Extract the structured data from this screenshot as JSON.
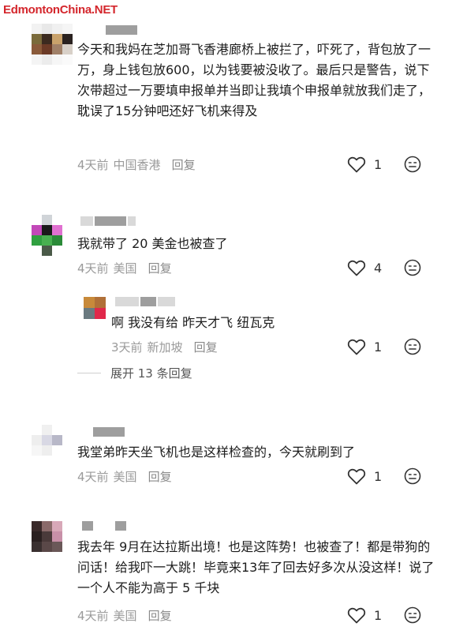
{
  "watermark": "EdmontonChina.NET",
  "comments": [
    {
      "text": "今天和我妈在芝加哥飞香港廊桥上被拦了，吓死了，背包放了一万，身上钱包放600，以为钱要被没收了。最后只是警告，说下次带超过一万要填申报单并当即让我填个申报单就放我们走了，耽误了15分钟吧还好飞机来得及",
      "time": "4天前",
      "location": "中国香港",
      "reply_label": "回复",
      "likes": "1"
    },
    {
      "text": "我就带了 20 美金也被查了",
      "time": "4天前",
      "location": "美国",
      "reply_label": "回复",
      "likes": "4",
      "reply": {
        "text": "啊 我没有给 昨天才飞 纽瓦克",
        "time": "3天前",
        "location": "新加坡",
        "reply_label": "回复",
        "likes": "1"
      },
      "expand_label": "展开 13 条回复"
    },
    {
      "text": "我堂弟昨天坐飞机也是这样检查的，今天就刷到了",
      "time": "4天前",
      "location": "美国",
      "reply_label": "回复",
      "likes": "1"
    },
    {
      "text": "我去年 9月在达拉斯出境！也是这阵势！也被查了！都是带狗的问话！给我吓一大跳！毕竟来13年了回去好多次从没这样！说了一个人不能为高于 5 千块",
      "time": "4天前",
      "location": "美国",
      "reply_label": "回复",
      "likes": "1"
    }
  ],
  "icons": {
    "like": "heart-outline-icon",
    "dislike": "neutral-face-icon"
  },
  "colors": {
    "watermark": "#d4262c",
    "meta": "#9a9a9a",
    "text": "#1c1c1c"
  }
}
